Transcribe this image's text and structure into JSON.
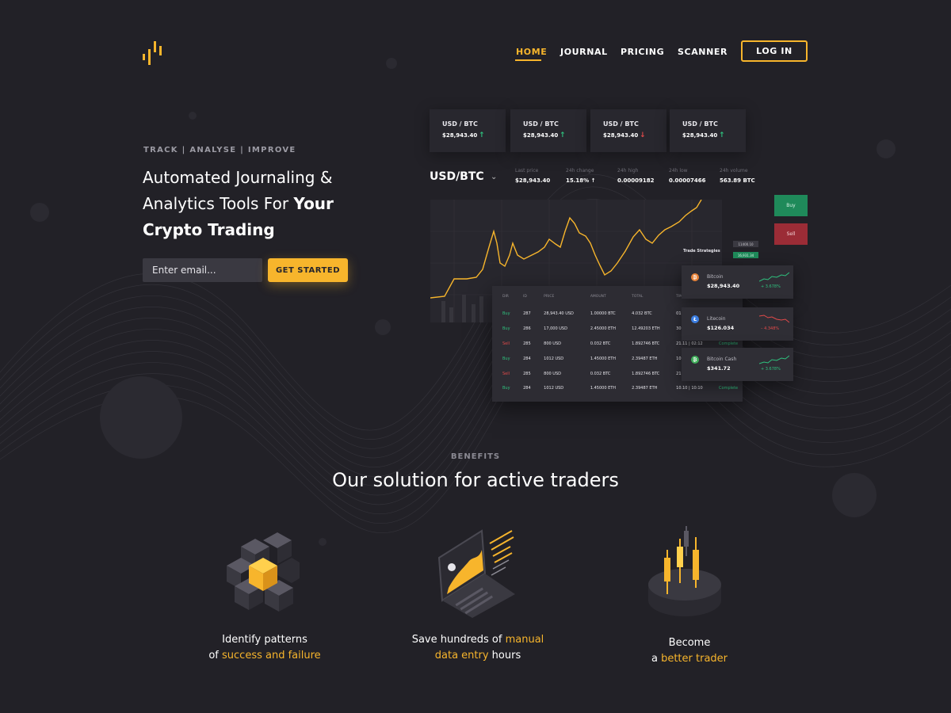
{
  "nav": {
    "links": [
      {
        "label": "HOME",
        "active": true
      },
      {
        "label": "JOURNAL",
        "active": false
      },
      {
        "label": "PRICING",
        "active": false
      },
      {
        "label": "SCANNER",
        "active": false
      }
    ],
    "login_label": "LOG IN"
  },
  "hero": {
    "eyebrow": "TRACK | ANALYSE | IMPROVE",
    "headline_line1": "Automated Journaling &",
    "headline_line2_regular": "Analytics Tools For ",
    "headline_line2_bold": "Your",
    "headline_line3": "Crypto Trading",
    "email_placeholder": "Enter email...",
    "cta_label": "GET STARTED"
  },
  "dashboard": {
    "tickers": [
      {
        "pair": "USD / BTC",
        "price": "$28,943.40",
        "direction": "up",
        "arrow": "↑"
      },
      {
        "pair": "USD / BTC",
        "price": "$28,943.40",
        "direction": "up",
        "arrow": "↑"
      },
      {
        "pair": "USD / BTC",
        "price": "$28,943.40",
        "direction": "down",
        "arrow": "↓"
      },
      {
        "pair": "USD / BTC",
        "price": "$28,943.40",
        "direction": "up",
        "arrow": "↑"
      }
    ],
    "pair_title": "USD/BTC",
    "stats": [
      {
        "label": "Last price",
        "value": "$28,943.40"
      },
      {
        "label": "24h change",
        "value": "15.18% ↑"
      },
      {
        "label": "24h high",
        "value": "0.00009182"
      },
      {
        "label": "24h low",
        "value": "0.00007466"
      },
      {
        "label": "24h volume",
        "value": "563.89 BTC"
      }
    ],
    "buy_label": "Buy",
    "sell_label": "Sell",
    "price_tag_a": "11400.10",
    "price_tag_b": "16,931.34",
    "trade_strategies_label": "Trade Strategies",
    "trades": {
      "columns": [
        "DIR",
        "ID",
        "PRICE",
        "AMOUNT",
        "TOTAL",
        "TIME",
        ""
      ],
      "rows": [
        [
          "Buy",
          "287",
          "28,943.40 USD",
          "1.00000 BTC",
          "4.032 BTC",
          "01.01 | 1",
          ""
        ],
        [
          "Buy",
          "286",
          "17,000 USD",
          "2.45000 ETH",
          "12.49203 ETH",
          "30.12 | 1",
          ""
        ],
        [
          "Sell",
          "285",
          "800 USD",
          "0.032 BTC",
          "1.892746 BTC",
          "21.11 | 02:12",
          "Complete"
        ],
        [
          "Buy",
          "284",
          "1012 USD",
          "1.45000 ETH",
          "2.39487 ETH",
          "10.10 | 10",
          ""
        ],
        [
          "Sell",
          "285",
          "800 USD",
          "0.032 BTC",
          "1.892746 BTC",
          "21.11 | 02",
          ""
        ],
        [
          "Buy",
          "284",
          "1012 USD",
          "1.45000 ETH",
          "2.39487 ETH",
          "10.10 | 10:10",
          "Complete"
        ]
      ]
    },
    "coins": [
      {
        "name": "Bitcoin",
        "price": "$28,943.40",
        "change": "+ 3.678%",
        "direction": "up",
        "color": "#e8843a",
        "glyph": "₿"
      },
      {
        "name": "Litecoin",
        "price": "$126.034",
        "change": "– 4.348%",
        "direction": "down",
        "color": "#3b7de0",
        "glyph": "Ł"
      },
      {
        "name": "Bitcoin Cash",
        "price": "$341.72",
        "change": "+ 3.678%",
        "direction": "up",
        "color": "#3fae5a",
        "glyph": "₿"
      }
    ]
  },
  "benefits": {
    "eyebrow": "BENEFITS",
    "title": "Our solution for active traders",
    "items": [
      {
        "icon": "cube-cluster-icon",
        "line1": "Identify patterns",
        "line2_prefix": "of ",
        "line2_highlight": "success and failure",
        "line2_suffix": ""
      },
      {
        "icon": "laptop-chart-icon",
        "line1_prefix": "Save hundreds of ",
        "line1_highlight": "manual",
        "line2_highlight": "data entry",
        "line2_suffix": " hours"
      },
      {
        "icon": "candlestick-icon",
        "line1": "Become",
        "line2_prefix": "a ",
        "line2_highlight": "better trader"
      }
    ]
  },
  "colors": {
    "background": "#222127",
    "accent": "#f7b52c",
    "positive": "#2ec27e",
    "negative": "#e24a4a"
  }
}
